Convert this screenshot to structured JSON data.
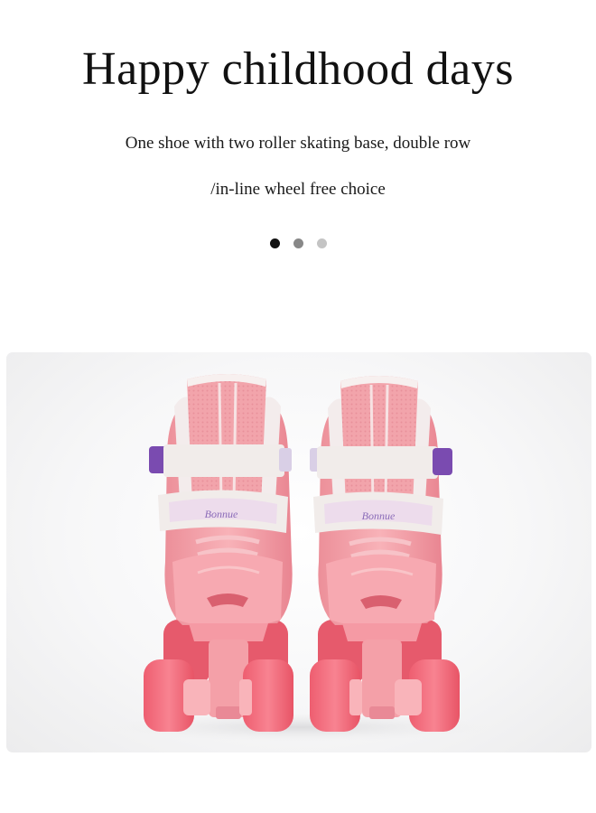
{
  "header": {
    "title": "Happy childhood days",
    "description_line1": "One shoe with two roller skating base, double row",
    "description_line2": "/in-line wheel free choice"
  },
  "carousel": {
    "active_index": 0,
    "dot_colors": [
      "#111111",
      "#888888",
      "#c4c4c4"
    ]
  },
  "product_photo": {
    "subject": "pink quad roller skates",
    "strap_logo": "Bonnue",
    "colors": {
      "boot": "#f4a0a8",
      "wheel": "#f36f7e",
      "strap": "#f1ecea",
      "buckle": "#7a4bb0",
      "background": "#f4f4f5"
    }
  }
}
